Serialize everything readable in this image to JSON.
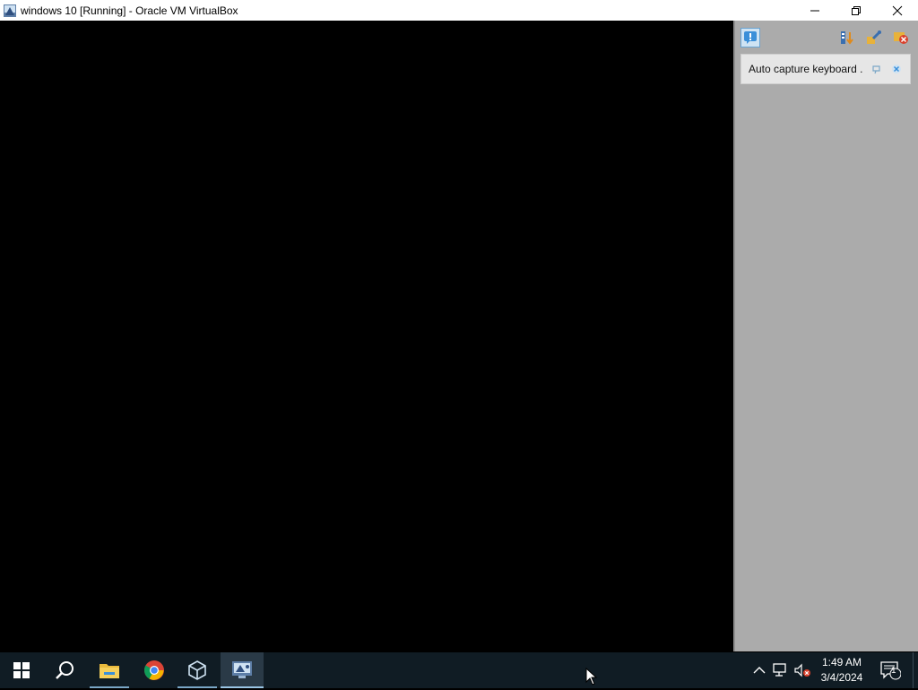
{
  "window": {
    "title": "windows 10 [Running] - Oracle VM VirtualBox",
    "icon": "virtualbox-vm-icon"
  },
  "window_controls": [
    "minimize",
    "restore",
    "close"
  ],
  "side_panel": {
    "toolbar_icons": [
      "notification-center-icon",
      "sort-icon",
      "keep-finished-icon",
      "delete-all-icon"
    ],
    "notifications": [
      {
        "text": "Auto capture keyboard ...",
        "actions": [
          "pin-icon",
          "close-icon"
        ]
      }
    ]
  },
  "taskbar": {
    "items": [
      {
        "name": "start",
        "icon": "windows-logo-icon"
      },
      {
        "name": "search",
        "icon": "search-icon"
      },
      {
        "name": "file-explorer",
        "icon": "folder-icon",
        "running": true
      },
      {
        "name": "chrome",
        "icon": "chrome-icon"
      },
      {
        "name": "virtualbox-manager",
        "icon": "virtualbox-icon",
        "running": true
      },
      {
        "name": "virtualbox-vm",
        "icon": "virtualbox-vm-icon",
        "active": true
      }
    ],
    "tray_icons": [
      "chevron-up-icon",
      "network-icon",
      "volume-muted-icon"
    ],
    "clock": {
      "time": "1:49 AM",
      "date": "3/4/2024"
    },
    "notifications_badge": "1"
  },
  "colors": {
    "taskbar": "#101c24",
    "side_panel": "#ababab",
    "notification_card": "#e6e6e6",
    "accent": "#3a8fd9"
  }
}
